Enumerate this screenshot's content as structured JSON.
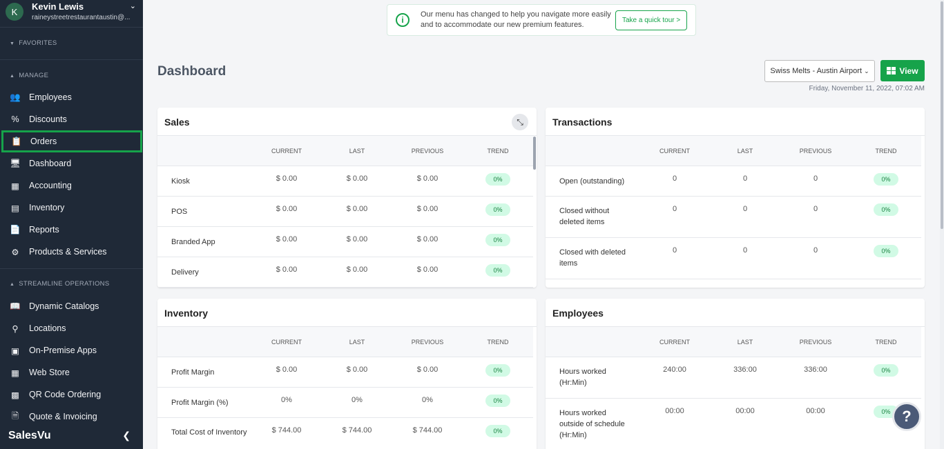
{
  "user": {
    "initial": "K",
    "name": "Kevin Lewis",
    "email": "raineystreetrestaurantaustin@..."
  },
  "sidebar": {
    "sections": {
      "favorites": "FAVORITES",
      "manage": "MANAGE",
      "streamline": "STREAMLINE OPERATIONS"
    },
    "manage_items": [
      {
        "label": "Employees",
        "icon": "employees-icon"
      },
      {
        "label": "Discounts",
        "icon": "percent-icon"
      },
      {
        "label": "Orders",
        "icon": "orders-icon"
      },
      {
        "label": "Dashboard",
        "icon": "monitor-icon"
      },
      {
        "label": "Accounting",
        "icon": "calculator-icon"
      },
      {
        "label": "Inventory",
        "icon": "shelves-icon"
      },
      {
        "label": "Reports",
        "icon": "reports-icon"
      },
      {
        "label": "Products & Services",
        "icon": "products-icon"
      }
    ],
    "streamline_items": [
      {
        "label": "Dynamic Catalogs",
        "icon": "catalog-icon"
      },
      {
        "label": "Locations",
        "icon": "location-pin-icon"
      },
      {
        "label": "On-Premise Apps",
        "icon": "apps-icon"
      },
      {
        "label": "Web Store",
        "icon": "web-store-icon"
      },
      {
        "label": "QR Code Ordering",
        "icon": "qr-code-icon"
      },
      {
        "label": "Quote & Invoicing",
        "icon": "invoice-icon"
      }
    ],
    "brand": "SalesVu",
    "active_color": "#16a34a"
  },
  "banner": {
    "message": "Our menu has changed to help you navigate more easily and to accommodate our new premium features.",
    "tour_label": "Take a quick tour >"
  },
  "header": {
    "title": "Dashboard",
    "store": "Swiss Melts - Austin Airport",
    "view_label": "View",
    "datetime": "Friday, November 11, 2022, 07:02 AM"
  },
  "columns": [
    "CURRENT",
    "LAST",
    "PREVIOUS",
    "TREND"
  ],
  "sales": {
    "title": "Sales",
    "rows": [
      {
        "label": "Kiosk",
        "current": "$ 0.00",
        "last": "$ 0.00",
        "previous": "$ 0.00",
        "trend": "0%"
      },
      {
        "label": "POS",
        "current": "$ 0.00",
        "last": "$ 0.00",
        "previous": "$ 0.00",
        "trend": "0%"
      },
      {
        "label": "Branded App",
        "current": "$ 0.00",
        "last": "$ 0.00",
        "previous": "$ 0.00",
        "trend": "0%"
      },
      {
        "label": "Delivery",
        "current": "$ 0.00",
        "last": "$ 0.00",
        "previous": "$ 0.00",
        "trend": "0%"
      }
    ]
  },
  "transactions": {
    "title": "Transactions",
    "rows": [
      {
        "label": "Open (outstanding)",
        "current": "0",
        "last": "0",
        "previous": "0",
        "trend": "0%"
      },
      {
        "label": "Closed without deleted items",
        "current": "0",
        "last": "0",
        "previous": "0",
        "trend": "0%"
      },
      {
        "label": "Closed with deleted items",
        "current": "0",
        "last": "0",
        "previous": "0",
        "trend": "0%"
      }
    ]
  },
  "inventory": {
    "title": "Inventory",
    "rows": [
      {
        "label": "Profit Margin",
        "current": "$ 0.00",
        "last": "$ 0.00",
        "previous": "$ 0.00",
        "trend": "0%"
      },
      {
        "label": "Profit Margin (%)",
        "current": "0%",
        "last": "0%",
        "previous": "0%",
        "trend": "0%"
      },
      {
        "label": "Total Cost of Inventory",
        "current": "$ 744.00",
        "last": "$ 744.00",
        "previous": "$ 744.00",
        "trend": "0%"
      }
    ]
  },
  "employees": {
    "title": "Employees",
    "rows": [
      {
        "label": "Hours worked (Hr:Min)",
        "current": "240:00",
        "last": "336:00",
        "previous": "336:00",
        "trend": "0%"
      },
      {
        "label": "Hours worked outside of schedule (Hr:Min)",
        "current": "00:00",
        "last": "00:00",
        "previous": "00:00",
        "trend": "0%"
      }
    ]
  },
  "help_label": "?"
}
